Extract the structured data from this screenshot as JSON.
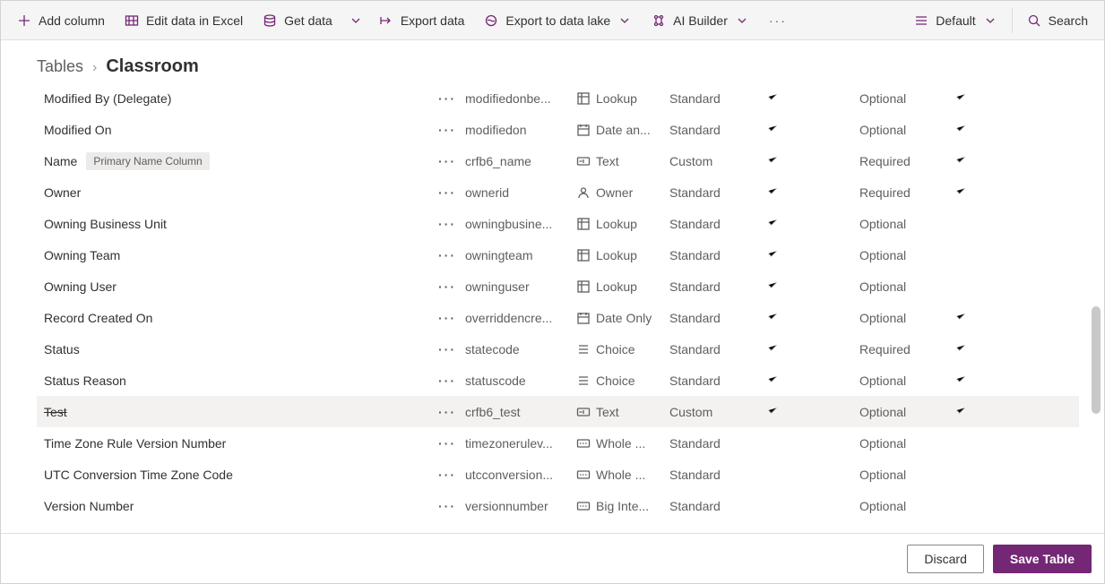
{
  "toolbar": {
    "add_column": "Add column",
    "edit_excel": "Edit data in Excel",
    "get_data": "Get data",
    "export_data": "Export data",
    "export_lake": "Export to data lake",
    "ai_builder": "AI Builder",
    "more": "···",
    "view": "Default",
    "search_placeholder": "Search"
  },
  "breadcrumb": {
    "root": "Tables",
    "current": "Classroom"
  },
  "primary_badge": "Primary Name Column",
  "rows": [
    {
      "display": "Modified By (Delegate)",
      "schema": "modifiedonbe...",
      "type": "Lookup",
      "type_icon": "lookup",
      "kind": "Standard",
      "chk1": true,
      "req": "Optional",
      "chk2": true,
      "strike": false,
      "badge": false,
      "sel": false
    },
    {
      "display": "Modified On",
      "schema": "modifiedon",
      "type": "Date an...",
      "type_icon": "date",
      "kind": "Standard",
      "chk1": true,
      "req": "Optional",
      "chk2": true,
      "strike": false,
      "badge": false,
      "sel": false
    },
    {
      "display": "Name",
      "schema": "crfb6_name",
      "type": "Text",
      "type_icon": "text",
      "kind": "Custom",
      "chk1": true,
      "req": "Required",
      "chk2": true,
      "strike": false,
      "badge": true,
      "sel": false
    },
    {
      "display": "Owner",
      "schema": "ownerid",
      "type": "Owner",
      "type_icon": "owner",
      "kind": "Standard",
      "chk1": true,
      "req": "Required",
      "chk2": true,
      "strike": false,
      "badge": false,
      "sel": false
    },
    {
      "display": "Owning Business Unit",
      "schema": "owningbusine...",
      "type": "Lookup",
      "type_icon": "lookup",
      "kind": "Standard",
      "chk1": true,
      "req": "Optional",
      "chk2": false,
      "strike": false,
      "badge": false,
      "sel": false
    },
    {
      "display": "Owning Team",
      "schema": "owningteam",
      "type": "Lookup",
      "type_icon": "lookup",
      "kind": "Standard",
      "chk1": true,
      "req": "Optional",
      "chk2": false,
      "strike": false,
      "badge": false,
      "sel": false
    },
    {
      "display": "Owning User",
      "schema": "owninguser",
      "type": "Lookup",
      "type_icon": "lookup",
      "kind": "Standard",
      "chk1": true,
      "req": "Optional",
      "chk2": false,
      "strike": false,
      "badge": false,
      "sel": false
    },
    {
      "display": "Record Created On",
      "schema": "overriddencre...",
      "type": "Date Only",
      "type_icon": "date",
      "kind": "Standard",
      "chk1": true,
      "req": "Optional",
      "chk2": true,
      "strike": false,
      "badge": false,
      "sel": false
    },
    {
      "display": "Status",
      "schema": "statecode",
      "type": "Choice",
      "type_icon": "choice",
      "kind": "Standard",
      "chk1": true,
      "req": "Required",
      "chk2": true,
      "strike": false,
      "badge": false,
      "sel": false
    },
    {
      "display": "Status Reason",
      "schema": "statuscode",
      "type": "Choice",
      "type_icon": "choice",
      "kind": "Standard",
      "chk1": true,
      "req": "Optional",
      "chk2": true,
      "strike": false,
      "badge": false,
      "sel": false
    },
    {
      "display": "Test",
      "schema": "crfb6_test",
      "type": "Text",
      "type_icon": "text",
      "kind": "Custom",
      "chk1": true,
      "req": "Optional",
      "chk2": true,
      "strike": true,
      "badge": false,
      "sel": true
    },
    {
      "display": "Time Zone Rule Version Number",
      "schema": "timezonerulev...",
      "type": "Whole ...",
      "type_icon": "number",
      "kind": "Standard",
      "chk1": false,
      "req": "Optional",
      "chk2": false,
      "strike": false,
      "badge": false,
      "sel": false
    },
    {
      "display": "UTC Conversion Time Zone Code",
      "schema": "utcconversion...",
      "type": "Whole ...",
      "type_icon": "number",
      "kind": "Standard",
      "chk1": false,
      "req": "Optional",
      "chk2": false,
      "strike": false,
      "badge": false,
      "sel": false
    },
    {
      "display": "Version Number",
      "schema": "versionnumber",
      "type": "Big Inte...",
      "type_icon": "number",
      "kind": "Standard",
      "chk1": false,
      "req": "Optional",
      "chk2": false,
      "strike": false,
      "badge": false,
      "sel": false
    }
  ],
  "footer": {
    "discard": "Discard",
    "save": "Save Table"
  }
}
